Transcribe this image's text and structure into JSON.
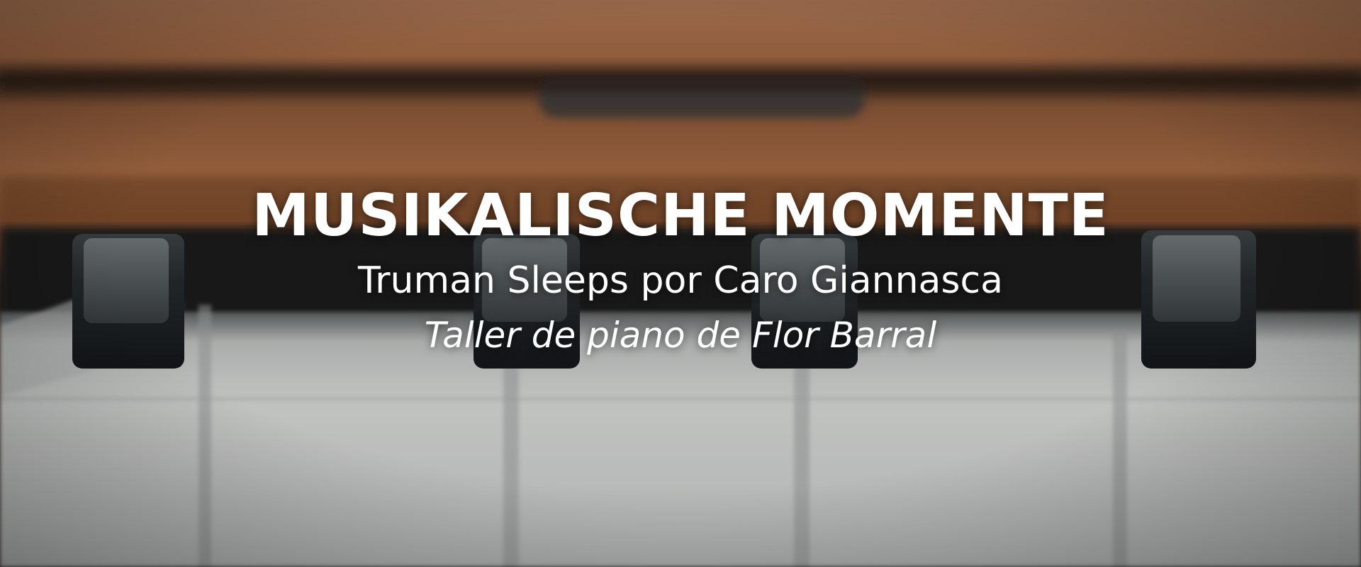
{
  "hero": {
    "title": "MUSIKALISCHE MOMENTE",
    "subtitle": "Truman Sleeps por Caro Giannasca",
    "tagline": "Taller de piano de Flor Barral",
    "background_image": "piano-keys-photo",
    "text_color": "#ffffff",
    "wood_color": "#a86a45",
    "key_white_color": "#dcdedc",
    "key_black_color": "#1d2226"
  }
}
